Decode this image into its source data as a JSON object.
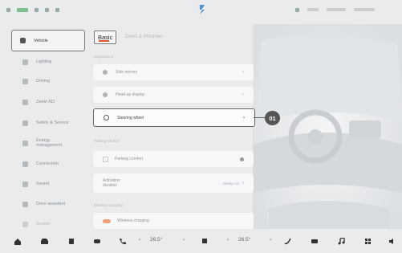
{
  "status_bar": {
    "left_items": [
      "",
      "",
      "",
      "",
      ""
    ],
    "right_items": [
      "",
      "",
      ""
    ]
  },
  "sidebar": {
    "items": [
      {
        "label": "Vehicle",
        "icon": "car-icon",
        "active": true
      },
      {
        "label": "Lighting",
        "icon": "lighting-icon"
      },
      {
        "label": "Driving",
        "icon": "driving-icon"
      },
      {
        "label": "Zeekr AD",
        "icon": "assist-icon"
      },
      {
        "label": "Safety & Service",
        "icon": "safety-icon"
      },
      {
        "label": "Energy management",
        "icon": "energy-icon"
      },
      {
        "label": "Connection",
        "icon": "connection-icon"
      },
      {
        "label": "Sound",
        "icon": "sound-icon"
      },
      {
        "label": "Drive assistant",
        "icon": "drive-assistant-icon"
      },
      {
        "label": "Screen",
        "icon": "screen-icon"
      }
    ]
  },
  "tabs": [
    {
      "label": "Basic",
      "active": true
    },
    {
      "label": "Doors & Windows",
      "active": false
    }
  ],
  "content": {
    "section_1": "Ergonomics",
    "rows_1": [
      {
        "label": "Side mirrors",
        "icon": "mirror-icon"
      },
      {
        "label": "Head-up display",
        "icon": "hud-icon"
      },
      {
        "label": "Steering wheel",
        "icon": "steering-wheel-icon",
        "highlight": true
      }
    ],
    "section_2": "Parking comfort",
    "parking_row": {
      "label": "Parking comfort"
    },
    "activation_row": {
      "label": "Activation duration",
      "value": "Always on"
    },
    "section_3": "Wireless charging",
    "wireless_row": {
      "label": "Wireless charging"
    }
  },
  "callout": {
    "label": "01"
  },
  "bottom_bar": {
    "temp_left": "26.5°",
    "temp_right": "26.5°",
    "icons": [
      "home-icon",
      "car-icon",
      "seat-icon",
      "fan-icon",
      "phone-icon",
      "seat-heat-icon",
      "steering-heat-icon",
      "defrost-icon",
      "music-icon",
      "apps-icon",
      "volume-icon"
    ]
  },
  "colors": {
    "accent": "#e05a2b",
    "highlight_border": "#666666",
    "callout_bg": "#555555"
  }
}
